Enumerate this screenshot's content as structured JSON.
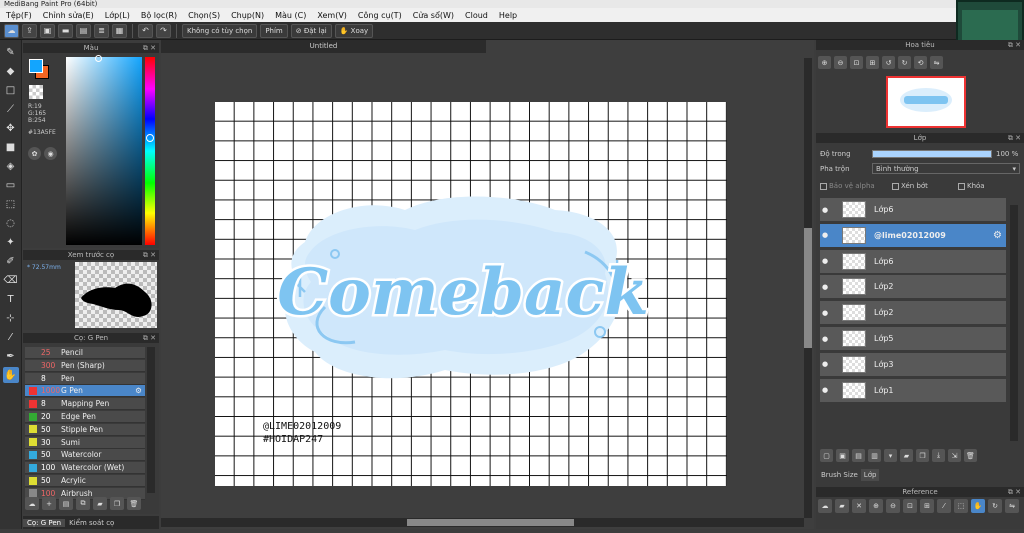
{
  "app": {
    "title": "MediBang Paint Pro (64bit)"
  },
  "menu": [
    "Tệp(F)",
    "Chỉnh sửa(E)",
    "Lớp(L)",
    "Bộ lọc(R)",
    "Chọn(S)",
    "Chụp(N)",
    "Màu (C)",
    "Xem(V)",
    "Công cụ(T)",
    "Cửa sổ(W)",
    "Cloud",
    "Help"
  ],
  "toolbar": {
    "option_label": "Không có tùy chọn",
    "key_label": "Phím",
    "reset_label": "Đặt lại",
    "rotate_label": "Xoay"
  },
  "color_panel": {
    "title": "Màu",
    "r": "R:19",
    "g": "G:165",
    "b": "B:254",
    "hex": "#13A5FE",
    "fg": "#13a5fe",
    "bg": "#f26522"
  },
  "brush_preview": {
    "title": "Xem trước cọ",
    "size": "72.57mm"
  },
  "brush_panel": {
    "title": "Cọ: G Pen",
    "items": [
      {
        "size": "25",
        "name": "Pencil",
        "color": "#4a4a4a",
        "sizecolor": "#e66"
      },
      {
        "size": "300",
        "name": "Pen (Sharp)",
        "color": "#4a4a4a",
        "sizecolor": "#e66"
      },
      {
        "size": "8",
        "name": "Pen",
        "color": "#4a4a4a",
        "sizecolor": "#fff"
      },
      {
        "size": "1000",
        "name": "G Pen",
        "color": "#e33",
        "sizecolor": "#e66"
      },
      {
        "size": "8",
        "name": "Mapping Pen",
        "color": "#e33",
        "sizecolor": "#fff"
      },
      {
        "size": "20",
        "name": "Edge Pen",
        "color": "#3a3",
        "sizecolor": "#fff"
      },
      {
        "size": "50",
        "name": "Stipple Pen",
        "color": "#dd3",
        "sizecolor": "#fff"
      },
      {
        "size": "30",
        "name": "Sumi",
        "color": "#dd3",
        "sizecolor": "#fff"
      },
      {
        "size": "50",
        "name": "Watercolor",
        "color": "#3ad",
        "sizecolor": "#fff"
      },
      {
        "size": "100",
        "name": "Watercolor (Wet)",
        "color": "#3ad",
        "sizecolor": "#fff"
      },
      {
        "size": "50",
        "name": "Acrylic",
        "color": "#dd3",
        "sizecolor": "#fff"
      },
      {
        "size": "100",
        "name": "Airbrush",
        "color": "#888",
        "sizecolor": "#e66"
      }
    ],
    "selected": 3
  },
  "bottom_tabs": [
    "Cọ: G Pen",
    "Kiểm soát cọ"
  ],
  "document": {
    "tab": "Untitled",
    "artwork_title": "Comeback",
    "signature_line1": "@LIME02012009",
    "signature_line2": "#HOIDAP247"
  },
  "navigator": {
    "title": "Hoa tiêu"
  },
  "layers": {
    "title": "Lớp",
    "opacity_label": "Độ trong",
    "opacity_value": "100 %",
    "blend_label": "Pha trộn",
    "blend_value": "Bình thường",
    "protect_alpha": "Bảo vệ alpha",
    "clip": "Xén bớt",
    "lock": "Khóa",
    "items": [
      "Lớp6",
      "@lime02012009",
      "Lớp6",
      "Lớp2",
      "Lớp2",
      "Lớp5",
      "Lớp3",
      "Lớp1"
    ],
    "selected": 1
  },
  "right_tabs": [
    "Brush Size",
    "Lớp"
  ],
  "reference": {
    "title": "Reference"
  }
}
